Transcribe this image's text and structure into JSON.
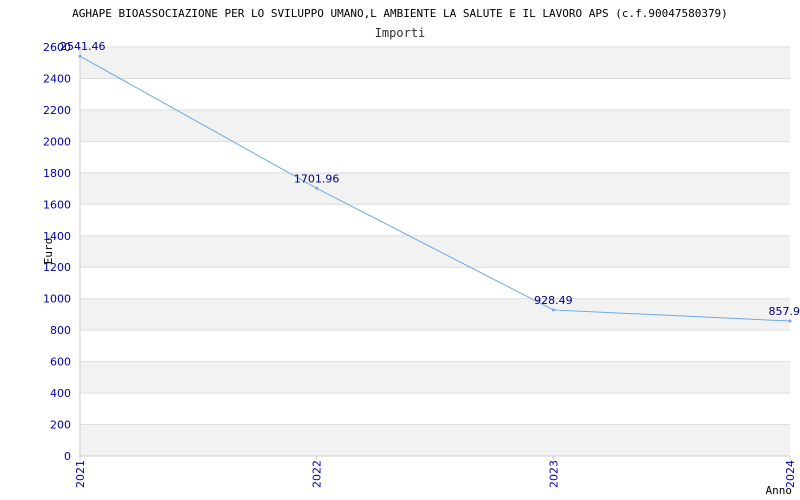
{
  "chart_data": {
    "type": "line",
    "title": "AGHAPE BIOASSOCIAZIONE PER LO SVILUPPO UMANO,L AMBIENTE LA SALUTE E IL LAVORO APS (c.f.90047580379)",
    "subtitle": "Importi",
    "xlabel": "Anno",
    "ylabel": "Euro",
    "x": [
      "2021",
      "2022",
      "2023",
      "2024"
    ],
    "series": [
      {
        "values": [
          2541.46,
          1701.96,
          928.49,
          857.9
        ],
        "labels": [
          "2541.46",
          "1701.96",
          "928.49",
          "857.9"
        ]
      }
    ],
    "ylim": [
      0,
      2600
    ],
    "yticks": [
      0,
      200,
      400,
      600,
      800,
      1000,
      1200,
      1400,
      1600,
      1800,
      2000,
      2200,
      2400,
      2600
    ],
    "grid": true,
    "colors": {
      "line": "#6aaae8",
      "band": "#f2f2f2",
      "tick_text": "#0000aa",
      "data_label": "#000080"
    }
  }
}
